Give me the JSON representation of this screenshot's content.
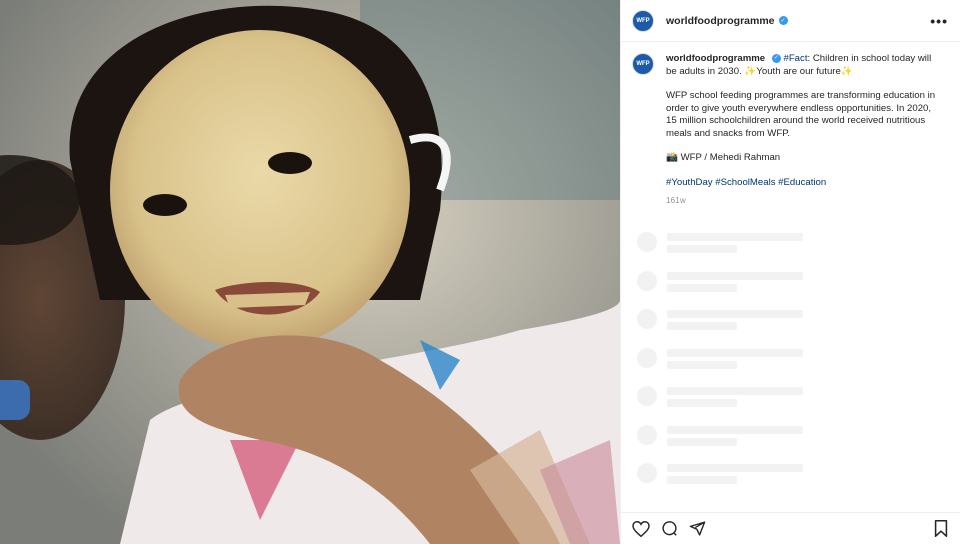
{
  "post": {
    "username": "worldfoodprogramme",
    "avatar_text": "WFP",
    "verified_icon": "verified-badge-icon",
    "more_icon": "more-options-icon",
    "more_label": "•••"
  },
  "caption": {
    "username": "worldfoodprogramme",
    "hashtag_fact": "#Fact",
    "line1_rest": ": Children in school today will be adults in 2030. ✨Youth are our future✨",
    "paragraph": "WFP school feeding programmes are transforming education in order to give youth everywhere endless opportunities. In 2020, 15 million schoolchildren around the world received nutritious meals and snacks from WFP.",
    "credit": "📸 WFP / Mehedi Rahman",
    "hashtags": "#YouthDay #SchoolMeals #Education",
    "timestamp": "161w"
  },
  "actions": {
    "like_icon": "heart-icon",
    "comment_icon": "comment-icon",
    "share_icon": "share-icon",
    "save_icon": "bookmark-icon"
  },
  "photo": {
    "description_icon": "post-photo"
  },
  "colors": {
    "link": "#00376b",
    "verified": "#3897f0",
    "avatar_bg": "#1d5ba8",
    "skeleton": "#f2f2f2"
  }
}
